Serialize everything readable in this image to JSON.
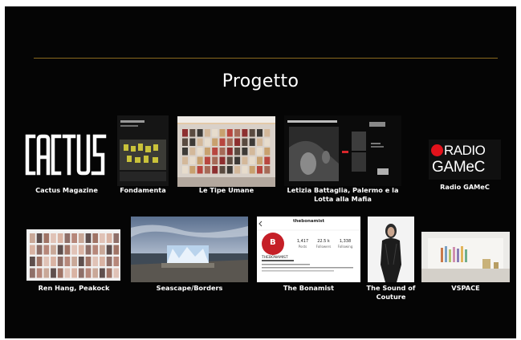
{
  "slide": {
    "title": "Progetto",
    "colors": {
      "background": "#050505",
      "rule": "#8a6a1e",
      "text": "#ffffff",
      "radio_dot": "#e3121b"
    },
    "projects": [
      {
        "id": "cactus",
        "label": "Cactus Magazine"
      },
      {
        "id": "fond",
        "label": "Fondamenta"
      },
      {
        "id": "tipe",
        "label": "Le Tipe Umane"
      },
      {
        "id": "leti",
        "label": "Letizia Battaglia, Palermo e la Lotta alla Mafia"
      },
      {
        "id": "radio",
        "label": "Radio GAMeC"
      },
      {
        "id": "ren",
        "label": "Ren Hang, Peakock"
      },
      {
        "id": "sea",
        "label": "Seascape/Borders"
      },
      {
        "id": "bon",
        "label": "The Bonamist"
      },
      {
        "id": "sound",
        "label": "The Sound of Couture"
      },
      {
        "id": "vspace",
        "label": "VSPACE"
      }
    ]
  },
  "logos": {
    "cactus": "CACTUS",
    "radio_line1": "RADIO",
    "radio_line2": "GAMeC"
  },
  "bonamist": {
    "handle": "thebonamist",
    "avatar_text": "B",
    "stats": [
      {
        "value": "1,417",
        "label": "Posts"
      },
      {
        "value": "22.5 k",
        "label": "Followers"
      },
      {
        "value": "1,338",
        "label": "Following"
      }
    ],
    "name": "THEBONAMIST"
  }
}
